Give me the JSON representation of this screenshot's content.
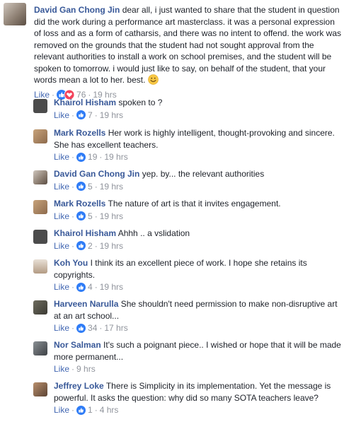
{
  "main_comment": {
    "author": "David Gan Chong Jin",
    "text": "dear all, i just wanted to share that the student in question did the work during a performance art masterclass. it was a personal expression of loss and as a form of catharsis, and there was no intent to offend. the work was removed on the grounds that the student had not sought approval from the relevant authorities to install a work on school premises, and the student will be spoken to tomorrow. i would just like to say, on behalf of the student, that your words mean a lot to her. best.",
    "emoji": "smile-emoji",
    "like_label": "Like",
    "reactions": [
      "like-icon",
      "love-icon"
    ],
    "reaction_count": "76",
    "time": "19 hrs"
  },
  "replies": [
    {
      "author": "Khairol Hisham",
      "text": "spoken to ?",
      "like_label": "Like",
      "reaction_count": "7",
      "time": "19 hrs",
      "has_reaction": true
    },
    {
      "author": "Mark Rozells",
      "text": "Her work is highly intelligent, thought-provoking and sincere. She has excellent teachers.",
      "like_label": "Like",
      "reaction_count": "19",
      "time": "19 hrs",
      "has_reaction": true
    },
    {
      "author": "David Gan Chong Jin",
      "text": "yep. by... the relevant authorities",
      "like_label": "Like",
      "reaction_count": "5",
      "time": "19 hrs",
      "has_reaction": true
    },
    {
      "author": "Mark Rozells",
      "text": "The nature of art is that it invites engagement.",
      "like_label": "Like",
      "reaction_count": "5",
      "time": "19 hrs",
      "has_reaction": true
    },
    {
      "author": "Khairol Hisham",
      "text": "Ahhh .. a vslidation",
      "like_label": "Like",
      "reaction_count": "2",
      "time": "19 hrs",
      "has_reaction": true
    },
    {
      "author": "Koh You",
      "text": "I think its an excellent piece of work. I hope she retains its copyrights.",
      "like_label": "Like",
      "reaction_count": "4",
      "time": "19 hrs",
      "has_reaction": true
    },
    {
      "author": "Harveen Narulla",
      "text": "She shouldn't need permission to make non-disruptive art at an art school...",
      "like_label": "Like",
      "reaction_count": "34",
      "time": "17 hrs",
      "has_reaction": true
    },
    {
      "author": "Nor Salman",
      "text": "It's such a poignant piece.. I wished or hope that it will be made more permanent...",
      "like_label": "Like",
      "reaction_count": "",
      "time": "9 hrs",
      "has_reaction": false
    },
    {
      "author": "Jeffrey Loke",
      "text": "There is Simplicity in its implementation. Yet the message is powerful. It asks the question: why did so many SOTA teachers leave?",
      "like_label": "Like",
      "reaction_count": "1",
      "time": "4 hrs",
      "has_reaction": true
    }
  ],
  "colors": {
    "name": "#385898",
    "like_link": "#4267b2",
    "meta": "#90949c",
    "like_blue": "#2f7cf6",
    "love_red": "#f3435b"
  }
}
